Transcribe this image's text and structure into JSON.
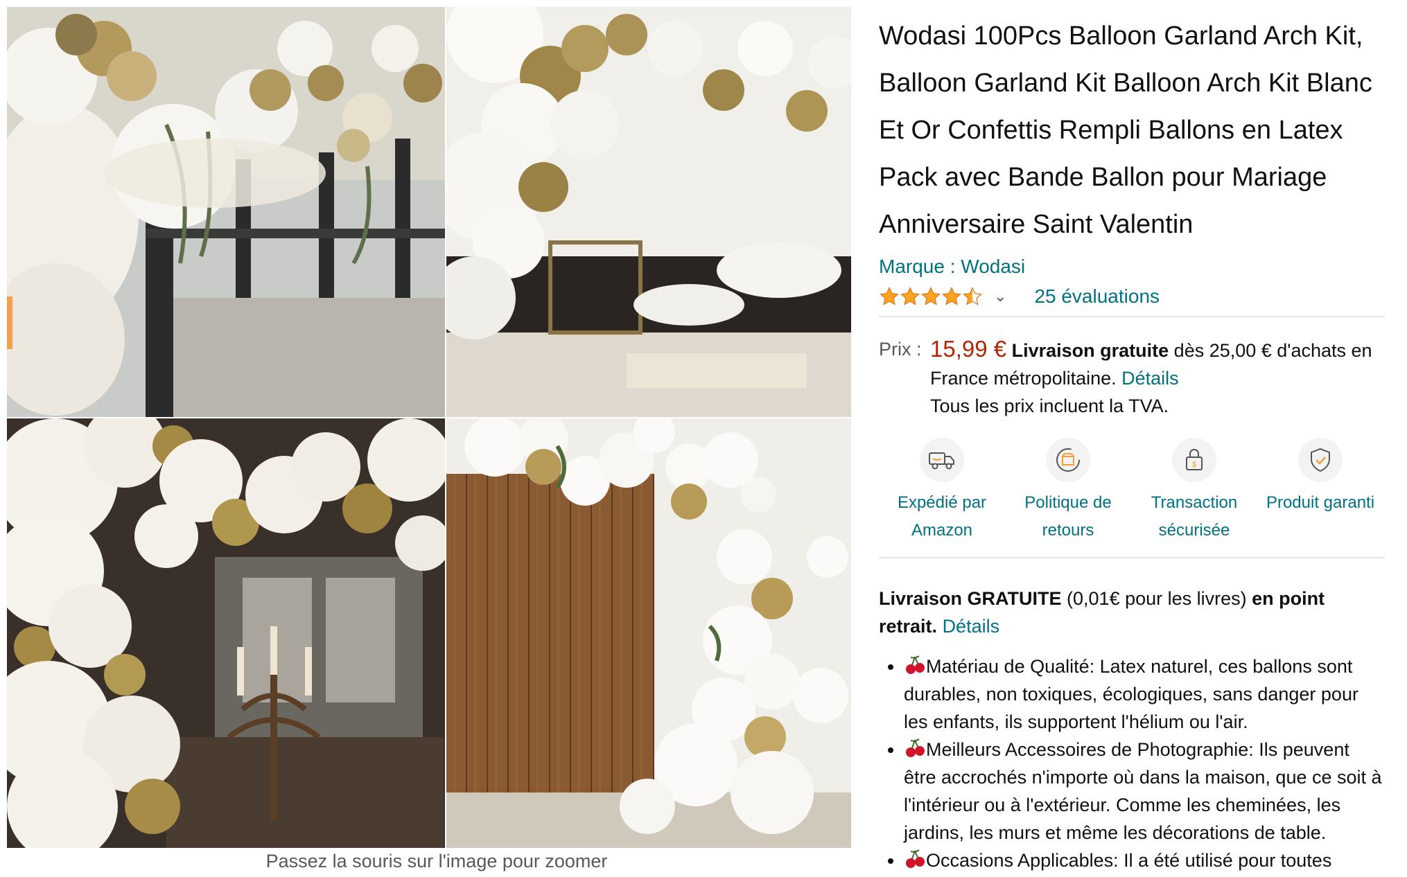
{
  "gallery": {
    "zoom_hint": "Passez la souris sur l'image pour zoomer"
  },
  "product": {
    "title": "Wodasi 100Pcs Balloon Garland Arch Kit, Balloon Garland Kit Balloon Arch Kit Blanc Et Or Confettis Rempli Ballons en Latex Pack avec Bande Ballon pour Mariage Anniversaire Saint Valentin",
    "brand_label": "Marque : Wodasi",
    "rating": 4.5,
    "reviews": "25 évaluations"
  },
  "price": {
    "label": "Prix :",
    "value": "15,99 €",
    "shipping_bold": "Livraison gratuite",
    "shipping_text": " dès 25,00 € d'achats en France métropolitaine. ",
    "details_link": "Détails",
    "tax_note": "Tous les prix incluent la TVA."
  },
  "badges": [
    {
      "label": "Expédié par Amazon",
      "icon": "truck-icon"
    },
    {
      "label": "Politique de retours",
      "icon": "return-box-icon"
    },
    {
      "label": "Transaction sécurisée",
      "icon": "lock-icon"
    },
    {
      "label": "Produit garanti",
      "icon": "shield-icon"
    }
  ],
  "delivery": {
    "bold1": "Livraison GRATUITE",
    "text": " (0,01€ pour les livres) ",
    "bold2": "en point retrait.",
    "link": "Détails"
  },
  "bullets": [
    "Matériau de Qualité: Latex naturel, ces ballons sont durables, non toxiques, écologiques, sans danger pour les enfants, ils supportent l'hélium ou l'air.",
    "Meilleurs Accessoires de Photographie: Ils peuvent être accrochés n'importe où dans la maison, que ce soit à l'intérieur ou à l'extérieur. Comme les cheminées, les jardins, les murs et même les décorations de table.",
    "Occasions Applicables: Il a été utilisé pour toutes"
  ],
  "colors": {
    "link": "#007185",
    "price": "#b12704",
    "star": "#ffa41c",
    "text": "#0f1111"
  }
}
